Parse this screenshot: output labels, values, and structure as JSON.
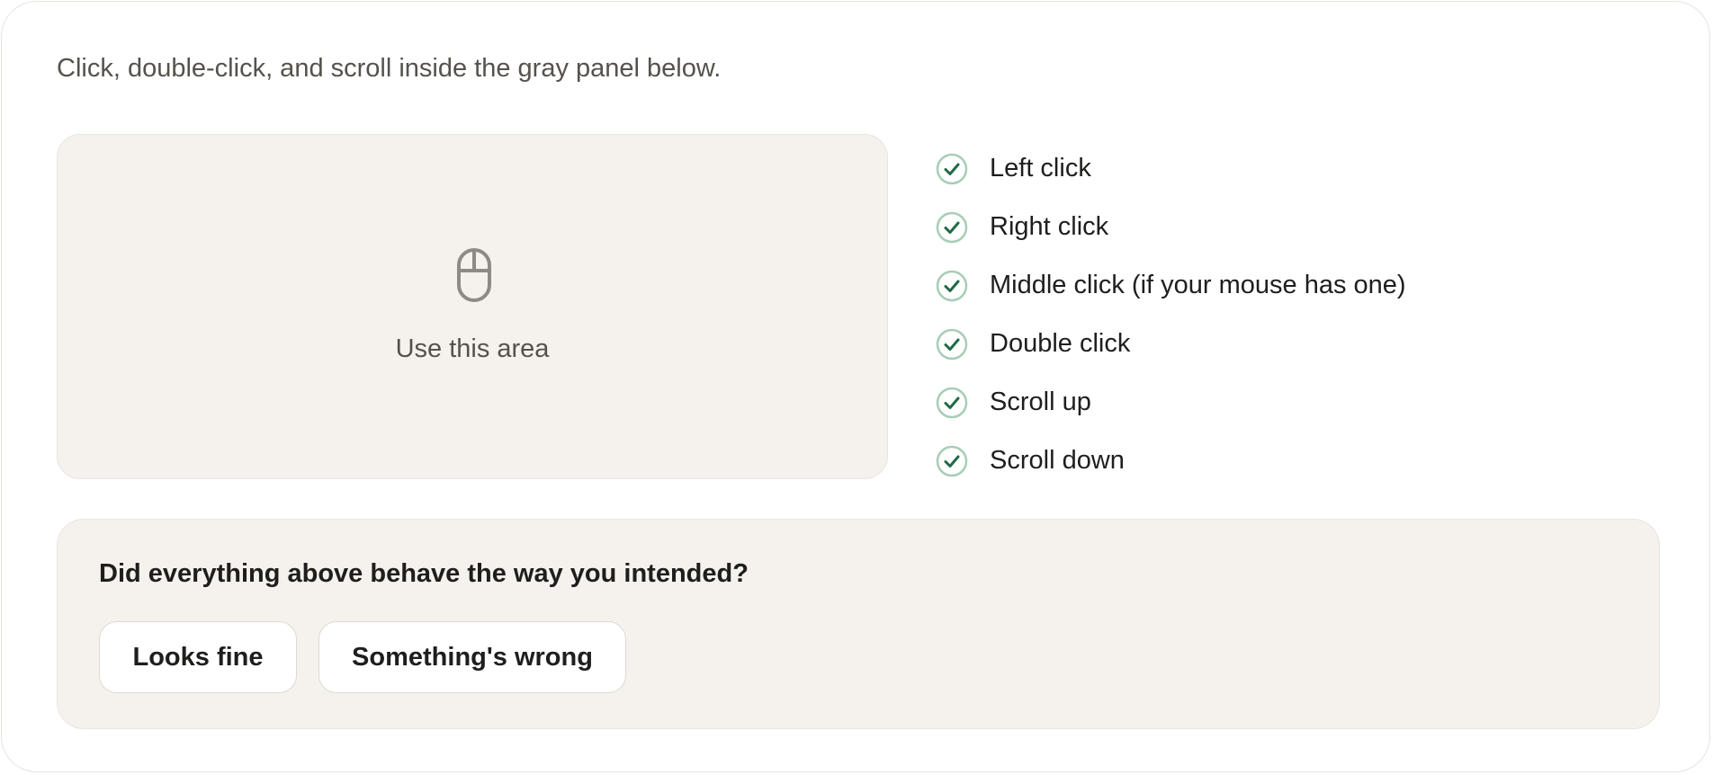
{
  "instruction": "Click, double-click, and scroll inside the gray panel below.",
  "test_area": {
    "icon": "mouse-icon",
    "label": "Use this area"
  },
  "checklist": {
    "icon": "check-circle-icon",
    "check_color": "#1f6b45",
    "ring_color": "#a8cdb6",
    "items": [
      {
        "label": "Left click",
        "done": true
      },
      {
        "label": "Right click",
        "done": true
      },
      {
        "label": "Middle click (if your mouse has one)",
        "done": true
      },
      {
        "label": "Double click",
        "done": true
      },
      {
        "label": "Scroll up",
        "done": true
      },
      {
        "label": "Scroll down",
        "done": true
      }
    ]
  },
  "feedback": {
    "question": "Did everything above behave the way you intended?",
    "looks_fine_label": "Looks fine",
    "something_wrong_label": "Something's wrong"
  }
}
